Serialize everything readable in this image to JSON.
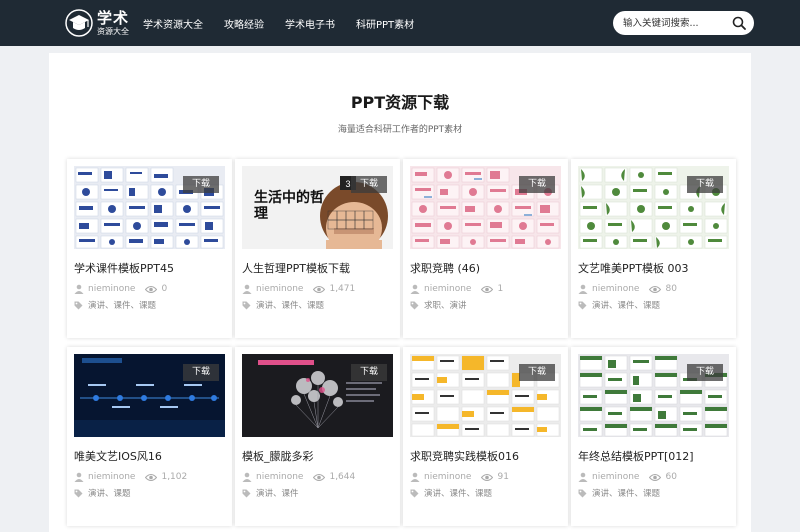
{
  "header": {
    "logo_big": "学术",
    "logo_small": "资源大全",
    "nav": [
      "学术资源大全",
      "攻略经验",
      "学术电子书",
      "科研PPT素材"
    ],
    "search_placeholder": "输入关键词搜索..."
  },
  "main": {
    "title": "PPT资源下载",
    "subtitle": "海量适合科研工作者的PPT素材",
    "download_label": "下载",
    "cards": [
      {
        "title": "学术课件模板PPT45",
        "author": "nieminone",
        "views": "0",
        "tags": "演讲、课件、课题",
        "thumb": "blue-grid"
      },
      {
        "title": "人生哲理PPT模板下载",
        "author": "nieminone",
        "views": "1,471",
        "tags": "演讲、课件、课题",
        "thumb": "boy-cover",
        "thumb_text": "生活中的哲理"
      },
      {
        "title": "求职竞聘 (46)",
        "author": "nieminone",
        "views": "1",
        "tags": "求职、演讲",
        "thumb": "pink-grid"
      },
      {
        "title": "文艺唯美PPT模板 003",
        "author": "nieminone",
        "views": "80",
        "tags": "演讲、课件、课题",
        "thumb": "green-leaf-grid"
      },
      {
        "title": "唯美文艺IOS风16",
        "author": "nieminone",
        "views": "1,102",
        "tags": "演讲、课题",
        "thumb": "dark-blue-timeline"
      },
      {
        "title": "模板_朦胧多彩",
        "author": "nieminone",
        "views": "1,644",
        "tags": "演讲、课件",
        "thumb": "dark-balloons"
      },
      {
        "title": "求职竞聘实践模板016",
        "author": "nieminone",
        "views": "91",
        "tags": "演讲、课件、课题",
        "thumb": "yellow-grid"
      },
      {
        "title": "年终总结模板PPT[012]",
        "author": "nieminone",
        "views": "60",
        "tags": "演讲、课件、课题",
        "thumb": "green-slides"
      }
    ]
  },
  "colors": {
    "header_bg": "#1f2a34",
    "page_bg": "#eef0f3",
    "panel_bg": "#ffffff"
  }
}
